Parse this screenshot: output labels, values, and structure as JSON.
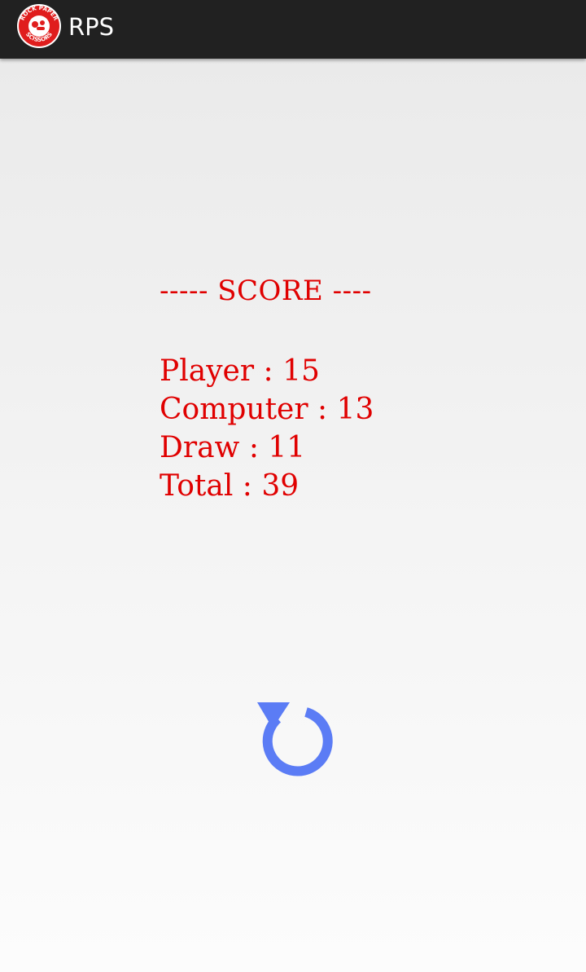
{
  "app_bar": {
    "title": "RPS",
    "logo_icon": "rock-paper-scissors-logo-icon",
    "logo_text": "ROCK PAPER SCISSORS",
    "background_color": "#212121"
  },
  "score": {
    "heading": "----- SCORE ----",
    "text_color": "#e00000",
    "rows": [
      {
        "label": "Player",
        "separator": ":",
        "value": "15"
      },
      {
        "label": "Computer",
        "separator": ":",
        "value": "13"
      },
      {
        "label": "Draw",
        "separator": ":",
        "value": "11"
      },
      {
        "label": "Total",
        "separator": ":",
        "value": "39"
      }
    ]
  },
  "controls": {
    "replay_icon": "replay-icon",
    "replay_color": "#5b7cf5"
  }
}
